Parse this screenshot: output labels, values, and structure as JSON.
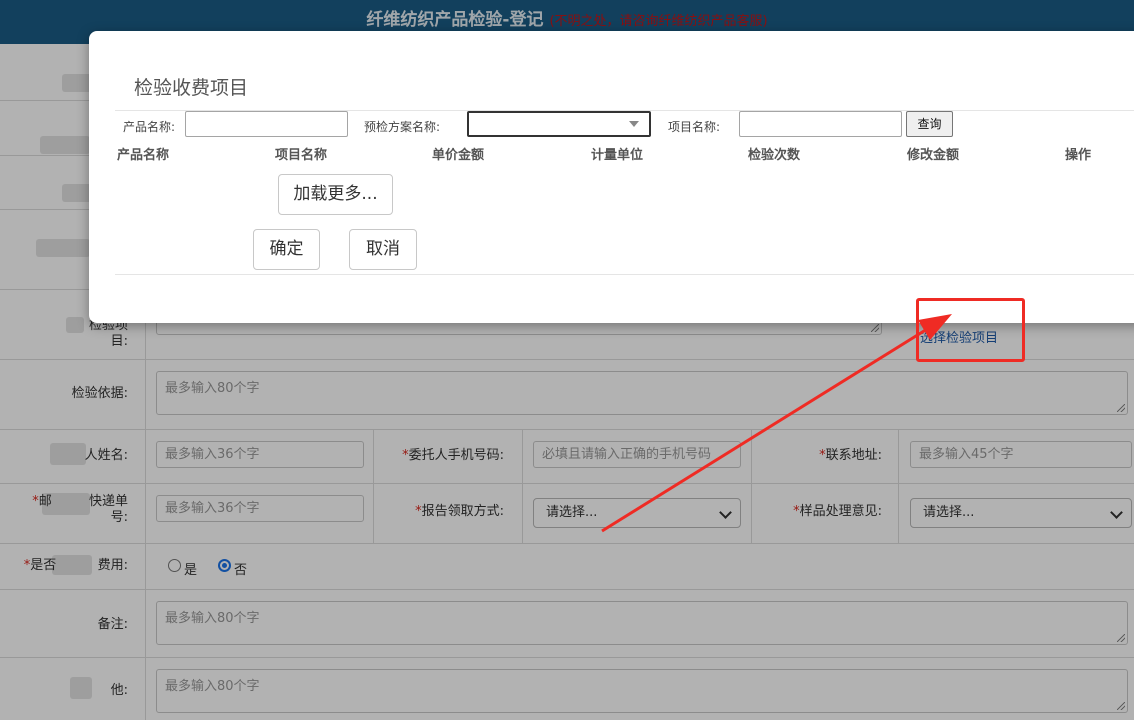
{
  "header": {
    "title": "纤维纺织产品检验-登记",
    "note": "(不明之处，请咨询纤维纺织产品客服)"
  },
  "form": {
    "rows": [
      {
        "label_suffix": "检验项目:",
        "select_link": "选择检验项目"
      },
      {
        "label": "检验依据:",
        "placeholder": "最多输入80个字"
      },
      {
        "label_suffix": "人姓名:",
        "placeholder": "最多输入36个字",
        "mobile_label": "*委托人手机号码:",
        "mobile_placeholder": "必填且请输入正确的手机号码",
        "address_label": "*联系地址:",
        "address_placeholder": "最多输入45个字"
      },
      {
        "label_suffix": "快递单号:",
        "placeholder": "最多输入36个字",
        "report_label": "*报告领取方式:",
        "report_value": "请选择...",
        "sample_label": "*样品处理意见:",
        "sample_value": "请选择..."
      },
      {
        "label_suffix": "费用:",
        "options": [
          "是",
          "否"
        ],
        "selected": "否"
      },
      {
        "label": "备注:",
        "placeholder": "最多输入80个字"
      },
      {
        "label_suffix": "他:",
        "placeholder": "最多输入80个字"
      }
    ]
  },
  "modal": {
    "title": "检验收费项目",
    "filters": {
      "product_label": "产品名称:",
      "plan_label": "预检方案名称:",
      "item_label": "项目名称:",
      "query_button": "查询"
    },
    "columns": [
      "产品名称",
      "项目名称",
      "单价金额",
      "计量单位",
      "检验次数",
      "修改金额",
      "操作"
    ],
    "load_more": "加载更多...",
    "confirm": "确定",
    "cancel": "取消"
  },
  "colors": {
    "header_bg": "#1a5c86",
    "required": "#d9261c",
    "link": "#1e5aa8",
    "annotation": "#ef2b24"
  }
}
